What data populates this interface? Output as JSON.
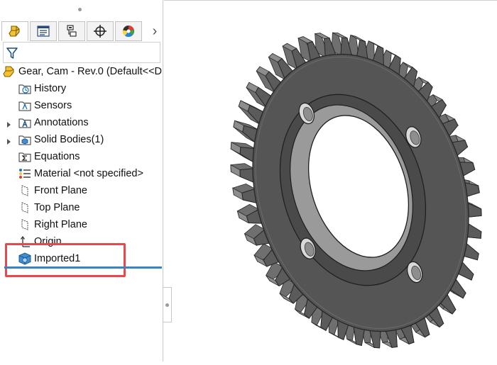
{
  "tabs": [
    {
      "name": "featuremanager",
      "icon": "featuremanager-tree-icon",
      "active": true
    },
    {
      "name": "propertymanager",
      "icon": "propertymanager-icon",
      "active": false
    },
    {
      "name": "configurationmanager",
      "icon": "configurationmanager-icon",
      "active": false
    },
    {
      "name": "dimxpertmanager",
      "icon": "crosshair-icon",
      "active": false
    },
    {
      "name": "displaymanager",
      "icon": "display-manager-icon",
      "active": false
    }
  ],
  "more_tabs_glyph": "›",
  "tree": {
    "root": {
      "label": "Gear, Cam - Rev.0  (Default<<D",
      "icon": "part-icon"
    },
    "items": [
      {
        "label": "History",
        "icon": "history-folder-icon",
        "expandable": false
      },
      {
        "label": "Sensors",
        "icon": "sensors-folder-icon",
        "expandable": false
      },
      {
        "label": "Annotations",
        "icon": "annotations-folder-icon",
        "expandable": true
      },
      {
        "label": "Solid Bodies(1)",
        "icon": "solid-bodies-folder-icon",
        "expandable": true
      },
      {
        "label": "Equations",
        "icon": "equations-folder-icon",
        "expandable": false
      },
      {
        "label": "Material <not specified>",
        "icon": "material-icon",
        "expandable": false
      },
      {
        "label": "Front Plane",
        "icon": "plane-icon",
        "expandable": false
      },
      {
        "label": "Top Plane",
        "icon": "plane-icon",
        "expandable": false
      },
      {
        "label": "Right Plane",
        "icon": "plane-icon",
        "expandable": false
      },
      {
        "label": "Origin",
        "icon": "origin-icon",
        "expandable": false
      },
      {
        "label": "Imported1",
        "icon": "imported-body-icon",
        "expandable": false,
        "highlighted": true
      }
    ]
  },
  "colors": {
    "highlight": "#e8474c",
    "rollback_bar": "#3a84c0",
    "gear_face": "#5b5b5b",
    "gear_tooth_top": "#8d8d8d"
  },
  "graphics": {
    "model": "gear-3d-model",
    "tooth_count": 42,
    "bolt_hole_count": 4
  }
}
